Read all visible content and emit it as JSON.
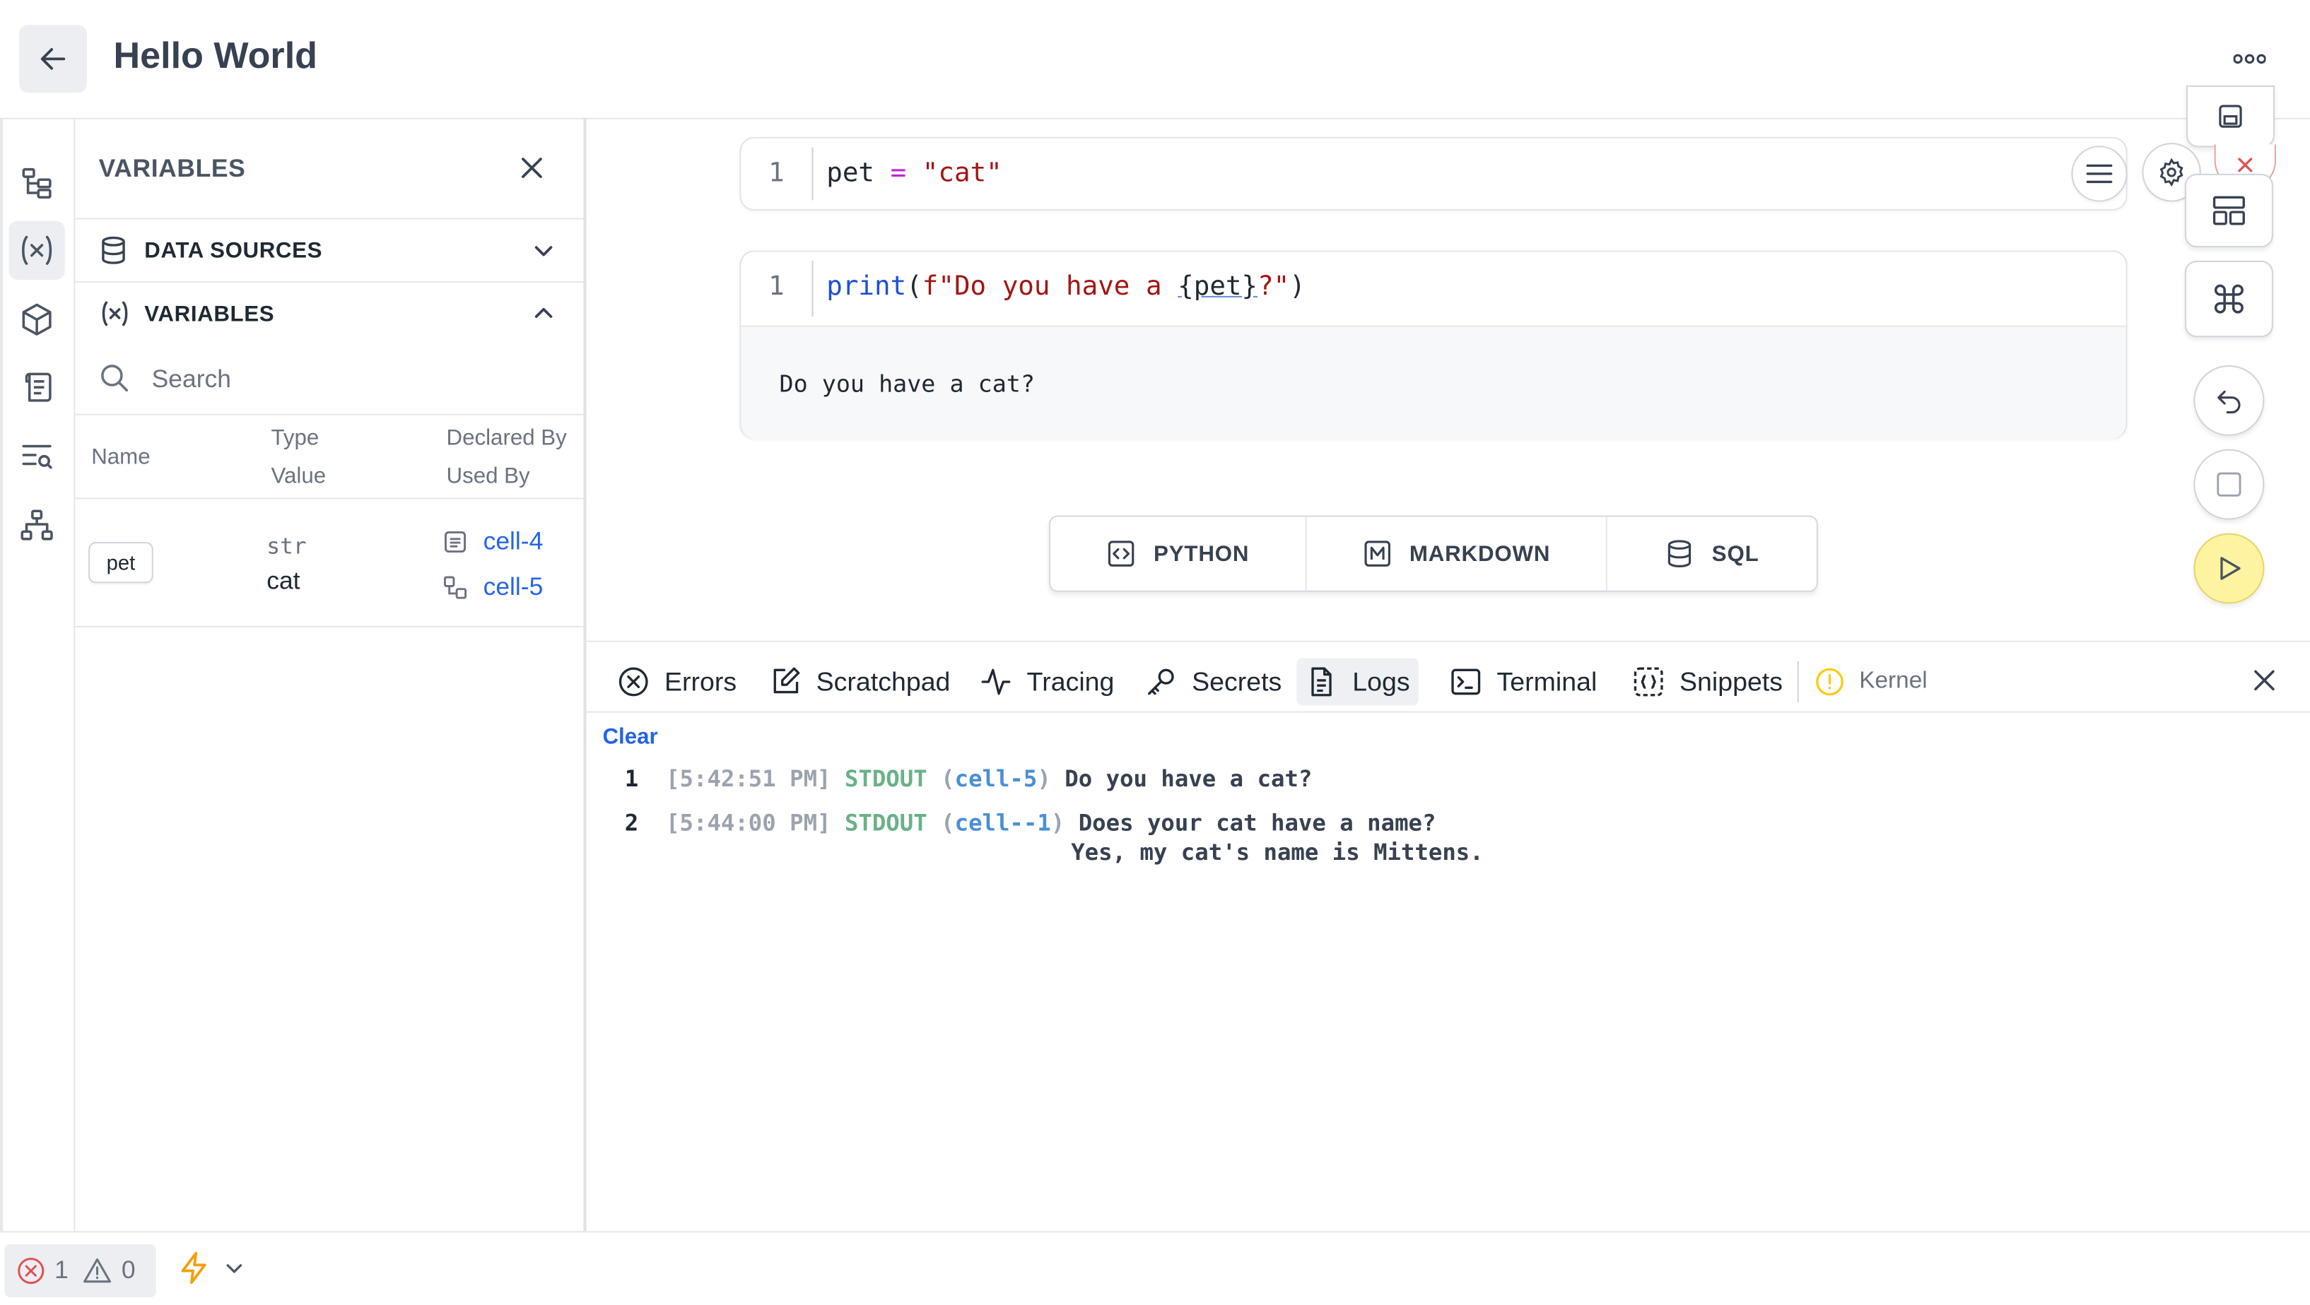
{
  "header": {
    "title": "Hello World"
  },
  "panel": {
    "title": "VARIABLES",
    "sections": {
      "data_sources": "DATA SOURCES",
      "variables": "VARIABLES"
    },
    "search_placeholder": "Search",
    "columns": {
      "name": "Name",
      "type": "Type",
      "value": "Value",
      "declared_by": "Declared By",
      "used_by": "Used By"
    },
    "variables": [
      {
        "name": "pet",
        "type": "str",
        "value": "cat",
        "declared_by": "cell-4",
        "used_by": "cell-5"
      }
    ]
  },
  "cells": [
    {
      "line_number": "1",
      "tokens": {
        "var": "pet",
        "op": "=",
        "str": "\"cat\""
      }
    },
    {
      "line_number": "1",
      "tokens": {
        "fn": "print",
        "open": "(",
        "fstr_a": "f\"Do you have a ",
        "interp": "{pet}",
        "fstr_b": "?\"",
        "close": ")"
      },
      "output": "Do you have a cat?"
    }
  ],
  "add_cell": {
    "python": "PYTHON",
    "markdown": "MARKDOWN",
    "sql": "SQL"
  },
  "bottom_panel": {
    "tabs": [
      "Errors",
      "Scratchpad",
      "Tracing",
      "Secrets",
      "Logs",
      "Terminal",
      "Snippets"
    ],
    "active_tab": "Logs",
    "kernel_label": "Kernel",
    "clear_label": "Clear",
    "logs": [
      {
        "n": "1",
        "time": "[5:42:51 PM]",
        "level": "STDOUT",
        "cell": "cell-5",
        "lines": [
          "Do you have a cat?"
        ]
      },
      {
        "n": "2",
        "time": "[5:44:00 PM]",
        "level": "STDOUT",
        "cell": "cell--1",
        "lines": [
          "Does your cat have a name?",
          "Yes, my cat's name is Mittens."
        ]
      }
    ]
  },
  "status_bar": {
    "errors": "1",
    "warnings": "0"
  },
  "colors": {
    "accent_link": "#2563eb",
    "log_level": "#6ab187",
    "run_button": "#fef3a0",
    "kernel_status": "#facc15",
    "error_red": "#e05252",
    "lightning": "#f59e0b"
  }
}
